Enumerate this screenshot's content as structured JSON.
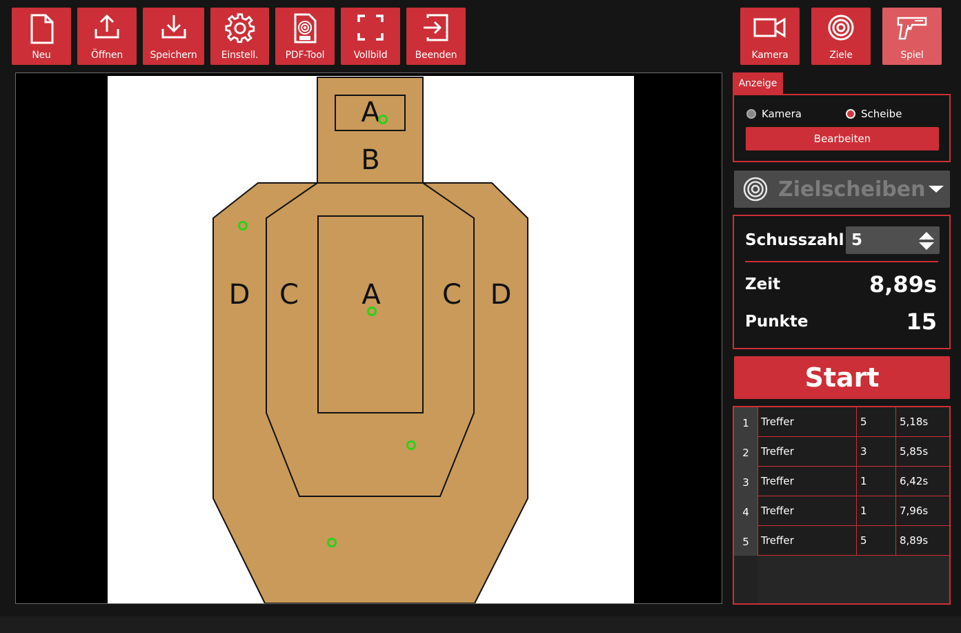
{
  "toolbar": {
    "left": [
      {
        "label": "Neu",
        "icon": "new-file-icon"
      },
      {
        "label": "Öffnen",
        "icon": "upload-icon"
      },
      {
        "label": "Speichern",
        "icon": "download-icon"
      },
      {
        "label": "Einstell.",
        "icon": "gear-icon"
      },
      {
        "label": "PDF-Tool",
        "icon": "pdf-target-icon"
      },
      {
        "label": "Vollbild",
        "icon": "fullscreen-icon"
      },
      {
        "label": "Beenden",
        "icon": "exit-icon"
      }
    ],
    "right": [
      {
        "label": "Kamera",
        "icon": "camera-icon"
      },
      {
        "label": "Ziele",
        "icon": "target-icon"
      },
      {
        "label": "Spiel",
        "icon": "pistol-icon",
        "active": true
      }
    ]
  },
  "target": {
    "zones": {
      "head_a": "A",
      "head_b": "B",
      "left_d": "D",
      "left_c": "C",
      "center_a": "A",
      "right_c": "C",
      "right_d": "D"
    },
    "hit_color": "#2bd11a",
    "target_color": "#c99a5a"
  },
  "anzeige": {
    "tab_label": "Anzeige",
    "radio_camera": "Kamera",
    "radio_scheibe": "Scheibe",
    "selected": "Scheibe",
    "edit_button": "Bearbeiten"
  },
  "ziel_select": {
    "value": "Zielscheiben"
  },
  "stats": {
    "schusszahl_label": "Schusszahl",
    "schusszahl_value": "5",
    "zeit_label": "Zeit",
    "zeit_value": "8,89s",
    "punkte_label": "Punkte",
    "punkte_value": "15"
  },
  "start_button": "Start",
  "results": [
    {
      "index": "1",
      "result": "Treffer",
      "points": "5",
      "time": "5,18s"
    },
    {
      "index": "2",
      "result": "Treffer",
      "points": "3",
      "time": "5,85s"
    },
    {
      "index": "3",
      "result": "Treffer",
      "points": "1",
      "time": "6,42s"
    },
    {
      "index": "4",
      "result": "Treffer",
      "points": "1",
      "time": "7,96s"
    },
    {
      "index": "5",
      "result": "Treffer",
      "points": "5",
      "time": "8,89s"
    }
  ],
  "colors": {
    "accent": "#cc2f37",
    "background": "#151515"
  }
}
